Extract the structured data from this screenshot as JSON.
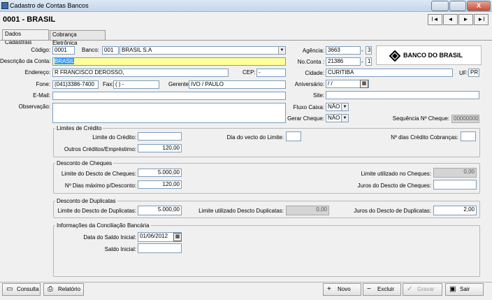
{
  "window": {
    "title": "Cadastro de Contas Bancos",
    "close_label": "X"
  },
  "record_title": "0001  -  BRASIL",
  "nav": {
    "first": "I◄",
    "prev": "◄",
    "next": "►",
    "last": "►I"
  },
  "tabs": [
    "Dados Cadastrais",
    "Cobrança Eletrônica"
  ],
  "labels": {
    "codigo": "Código:",
    "banco": "Banco:",
    "descricao": "Descrição da Conta:",
    "endereco": "Endereço:",
    "cep": "CEP:",
    "fone": "Fone:",
    "fax": "Fax:",
    "gerente": "Gerente:",
    "email": "E-Mail:",
    "observacao": "Observação:",
    "agencia": "Agência:",
    "noconta": "No.Conta :",
    "cidade": "Cidade:",
    "uf": "UF:",
    "aniversario": "Aniversário:",
    "site": "Site:",
    "fluxo": "Fluxo Caixa:",
    "gerar": "Gerar Cheque:",
    "sequencia": "Sequência Nº Cheque:"
  },
  "values": {
    "codigo": "0001",
    "banco_code": "001",
    "banco_name": "BRASIL S.A",
    "descricao": "BRASIL",
    "endereco": "R FRANCISCO DEROSSO,",
    "cep": " -",
    "fone": "(041)3386-7400",
    "fax": "(  )    -",
    "gerente": "IVO / PAULO",
    "email": "",
    "observacao": "",
    "agencia": "3663",
    "agencia_dv": "3",
    "noconta": "21386",
    "noconta_dv": "1",
    "cidade": "CURITIBA",
    "uf": "PR",
    "aniversario": " / /",
    "site": "",
    "fluxo": "NÃO",
    "gerar": "NÃO",
    "sequencia": "00000000"
  },
  "logo_text": "BANCO DO BRASIL",
  "limites": {
    "title": "Limites de Crédito",
    "credito_label": "Limite do Crédito:",
    "credito": "",
    "outros_label": "Outros Créditos/Empréstimo:",
    "outros": "120,00",
    "vecto_label": "Dia do vecto do Limite:",
    "vecto": "",
    "dias_label": "Nº dias Crédito Cobranças:",
    "dias": ""
  },
  "cheques": {
    "title": "Desconto de Cheques",
    "limite_label": "Limite do Descto de Cheques:",
    "limite": "5.000,00",
    "dias_label": "Nº Dias máximo p/Desconto:",
    "dias": "120,00",
    "utilizado_label": "Limite utilizado no Cheques:",
    "utilizado": "0,00",
    "juros_label": "Juros do Descto de Cheques:",
    "juros": ""
  },
  "duplicatas": {
    "title": "Desconto de Duplicatas",
    "limite_label": "Limite do Descto de Duplicatas:",
    "limite": "5.000,00",
    "utilizado_label": "Limite utilizado Descto Duplicatas:",
    "utilizado": "0,00",
    "juros_label": "Juros do Descto de Duplicatas:",
    "juros": "2,00"
  },
  "conciliacao": {
    "title": "Informações da Conciliação Bancária",
    "data_label": "Data do Saldo Inicial:",
    "data": "01/06/2012",
    "saldo_label": "Saldo Inicial:",
    "saldo": ""
  },
  "buttons": {
    "consulta": "Consulta",
    "relatorio": "Relatório",
    "novo": "Novo",
    "excluir": "Excluir",
    "gravar": "Gravar",
    "sair": "Sair"
  }
}
